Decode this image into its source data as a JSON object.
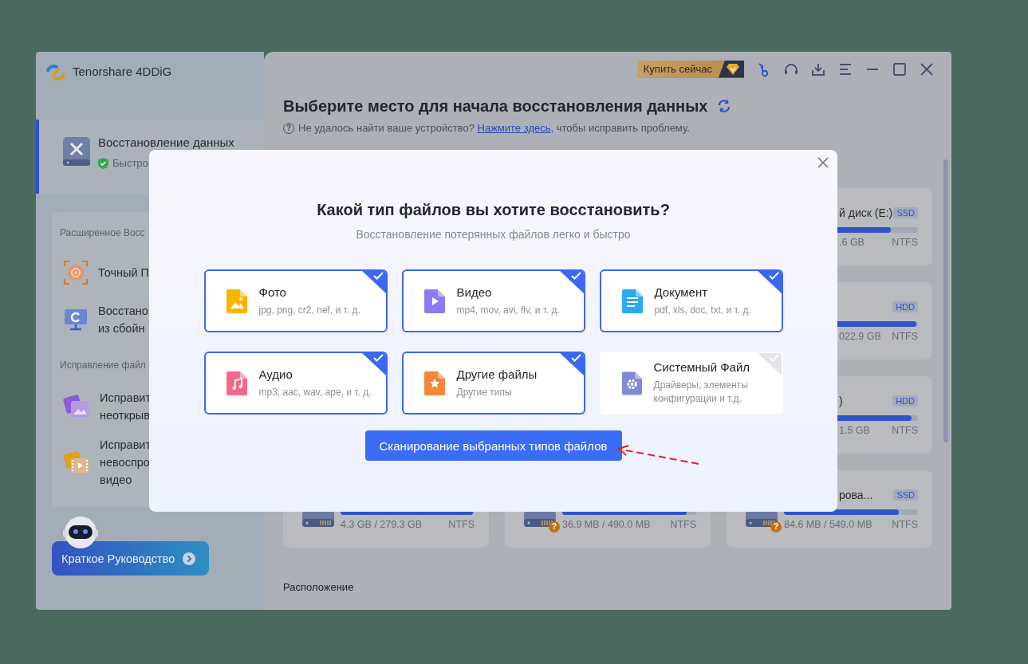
{
  "app": {
    "title": "Tenorshare 4DDiG"
  },
  "toolbar": {
    "buy_button": "Купить сейчас"
  },
  "sidebar": {
    "items": [
      {
        "label": "Восстановление данных",
        "sublabel": "Быстро",
        "kind": "data-recovery",
        "selected": true
      }
    ],
    "sections": [
      {
        "title": "Расширенное Восс",
        "items": [
          {
            "label": "Точный П",
            "kind": "target",
            "selected": false
          },
          {
            "label": "Восстано\nиз сбойн",
            "kind": "monitor",
            "selected": false
          }
        ]
      },
      {
        "title": "Исправление файл",
        "items": [
          {
            "label": "Исправит\nнеоткрыв",
            "kind": "photo-repair",
            "selected": false
          },
          {
            "label": "Исправит\nневоспро\nвидео",
            "kind": "video-repair",
            "selected": false
          }
        ]
      }
    ],
    "guide_button": "Краткое Руководство"
  },
  "main": {
    "title": "Выберите место для начала восстановления данных",
    "help": {
      "icon": "?",
      "before": "Не удалось найти ваше устройство? ",
      "link": "Нажмите здесь",
      "after": ", чтобы исправить проблему."
    },
    "right_disks": [
      {
        "name": "й диск (E:)",
        "type": "SSD",
        "level": 0.8,
        "size": ".6 GB",
        "filesystem": "NTFS"
      },
      {
        "type": "HDD",
        "level": 0.99,
        "size": "022.9 GB",
        "filesystem": "NTFS"
      },
      {
        "name": ")",
        "type": "HDD",
        "level": 0.95,
        "size": "1.5 GB",
        "filesystem": "NTFS"
      }
    ],
    "bottom_disks": [
      {
        "level": 0.99,
        "size": "4.3 GB / 279.3 GB",
        "filesystem": "NTFS"
      },
      {
        "level": 0.93,
        "size": "36.9 MB / 490.0 MB",
        "filesystem": "NTFS",
        "status_mark": "?"
      },
      {
        "name": "рова...",
        "type": "SSD",
        "level": 0.86,
        "size": "84.6 MB / 549.0 MB",
        "filesystem": "NTFS",
        "status_mark": "?"
      }
    ],
    "section_label": "Расположение"
  },
  "dialog": {
    "title": "Какой тип файлов вы хотите восстановить?",
    "subtitle": "Восстановление потерянных файлов легко и быстро",
    "file_types": [
      {
        "label": "Фото",
        "extensions": "jpg, png, cr2, nef, и т. д.",
        "kind": "photo",
        "checked": true
      },
      {
        "label": "Видео",
        "extensions": "mp4, mov, avi, flv, и т. д.",
        "kind": "video",
        "checked": true
      },
      {
        "label": "Документ",
        "extensions": "pdf, xls, doc, txt, и т. д.",
        "kind": "document",
        "checked": true
      },
      {
        "label": "Аудио",
        "extensions": "mp3, aac, wav, ape, и т. д.",
        "kind": "audio",
        "checked": true
      },
      {
        "label": "Другие файлы",
        "extensions": "Другие типы",
        "kind": "other",
        "checked": true
      },
      {
        "label": "Системный Файл",
        "extensions": "Драйверы, элементы конфигурации и т.д.",
        "kind": "system",
        "checked": false
      }
    ],
    "scan_button": "Сканирование выбранных типов файлов"
  }
}
